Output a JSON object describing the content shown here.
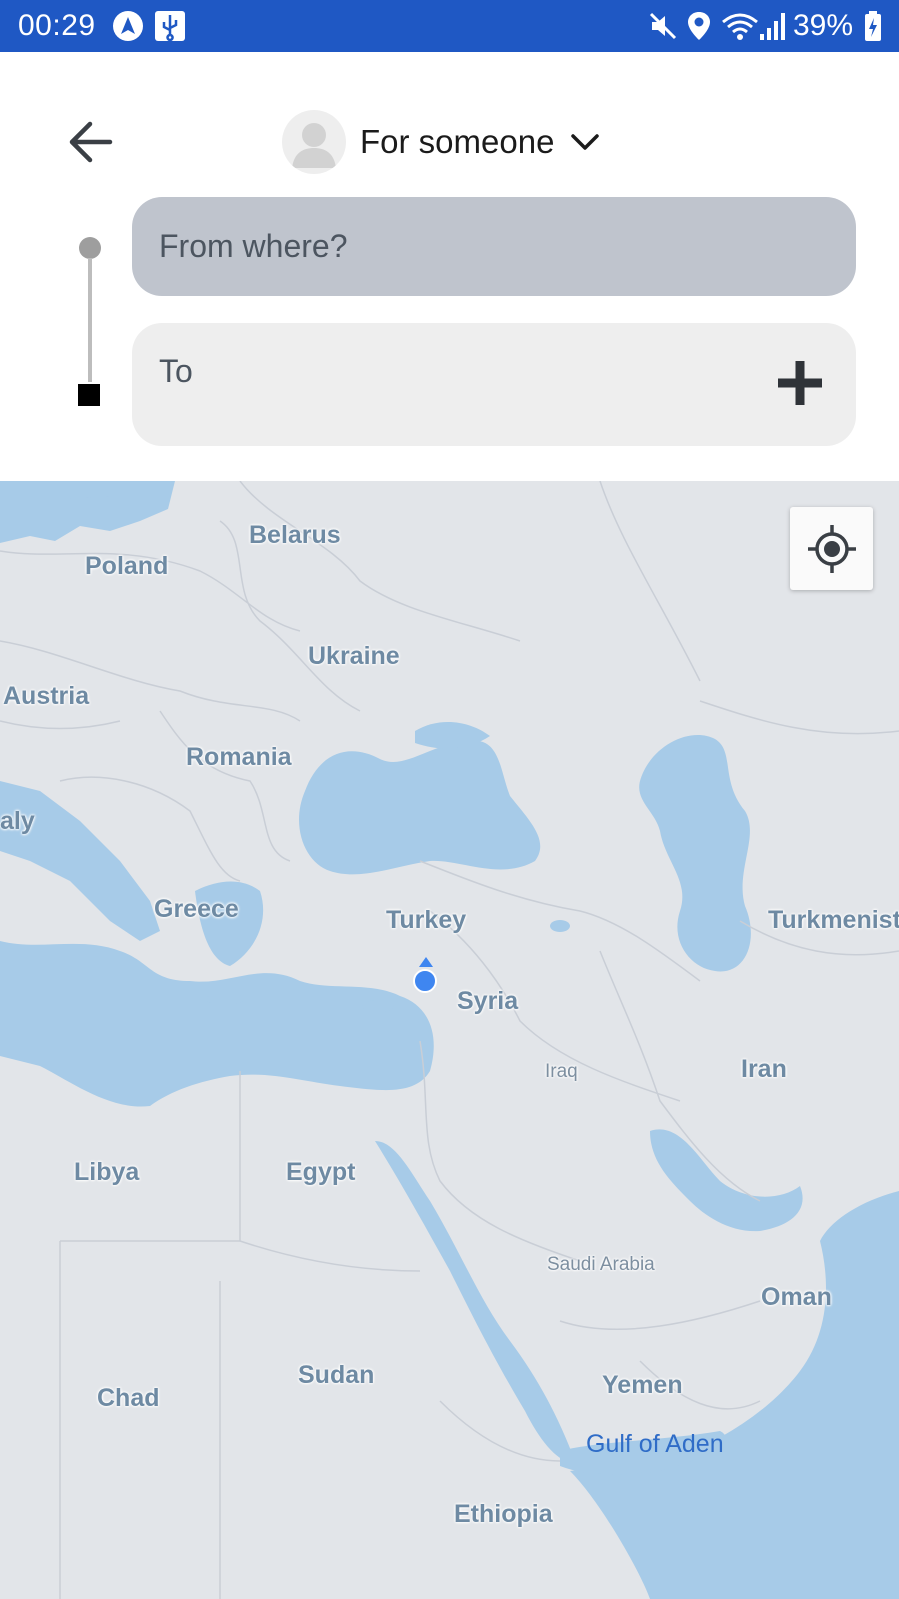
{
  "status_bar": {
    "time": "00:29",
    "battery": "39%",
    "icons": [
      "navigation-app-icon",
      "usb-icon",
      "mute-icon",
      "location-icon",
      "wifi-icon",
      "signal-icon",
      "battery-charging-icon"
    ]
  },
  "header": {
    "back_icon": "arrow-left-icon",
    "selector_label": "For someone",
    "selector_icon": "chevron-down-icon"
  },
  "route": {
    "from_placeholder": "From where?",
    "to_placeholder": "To",
    "add_stop_icon": "plus-icon"
  },
  "map": {
    "locate_icon": "my-location-icon",
    "colors": {
      "land": "#e2e5e9",
      "water": "#a7cbe8",
      "user_dot": "#3f86f0"
    },
    "labels": [
      {
        "id": "belarus",
        "text": "Belarus"
      },
      {
        "id": "poland",
        "text": "Poland"
      },
      {
        "id": "ukraine",
        "text": "Ukraine"
      },
      {
        "id": "austria",
        "text": "Austria"
      },
      {
        "id": "romania",
        "text": "Romania"
      },
      {
        "id": "italy",
        "text": "aly"
      },
      {
        "id": "greece",
        "text": "Greece"
      },
      {
        "id": "turkey",
        "text": "Turkey"
      },
      {
        "id": "turkmenistan",
        "text": "Turkmenist"
      },
      {
        "id": "syria",
        "text": "Syria"
      },
      {
        "id": "iraq",
        "text": "Iraq"
      },
      {
        "id": "iran",
        "text": "Iran"
      },
      {
        "id": "libya",
        "text": "Libya"
      },
      {
        "id": "egypt",
        "text": "Egypt"
      },
      {
        "id": "saudi",
        "text": "Saudi Arabia"
      },
      {
        "id": "oman",
        "text": "Oman"
      },
      {
        "id": "sudan",
        "text": "Sudan"
      },
      {
        "id": "chad",
        "text": "Chad"
      },
      {
        "id": "yemen",
        "text": "Yemen"
      },
      {
        "id": "aden",
        "text": "Gulf of Aden"
      },
      {
        "id": "ethiopia",
        "text": "Ethiopia"
      }
    ]
  }
}
